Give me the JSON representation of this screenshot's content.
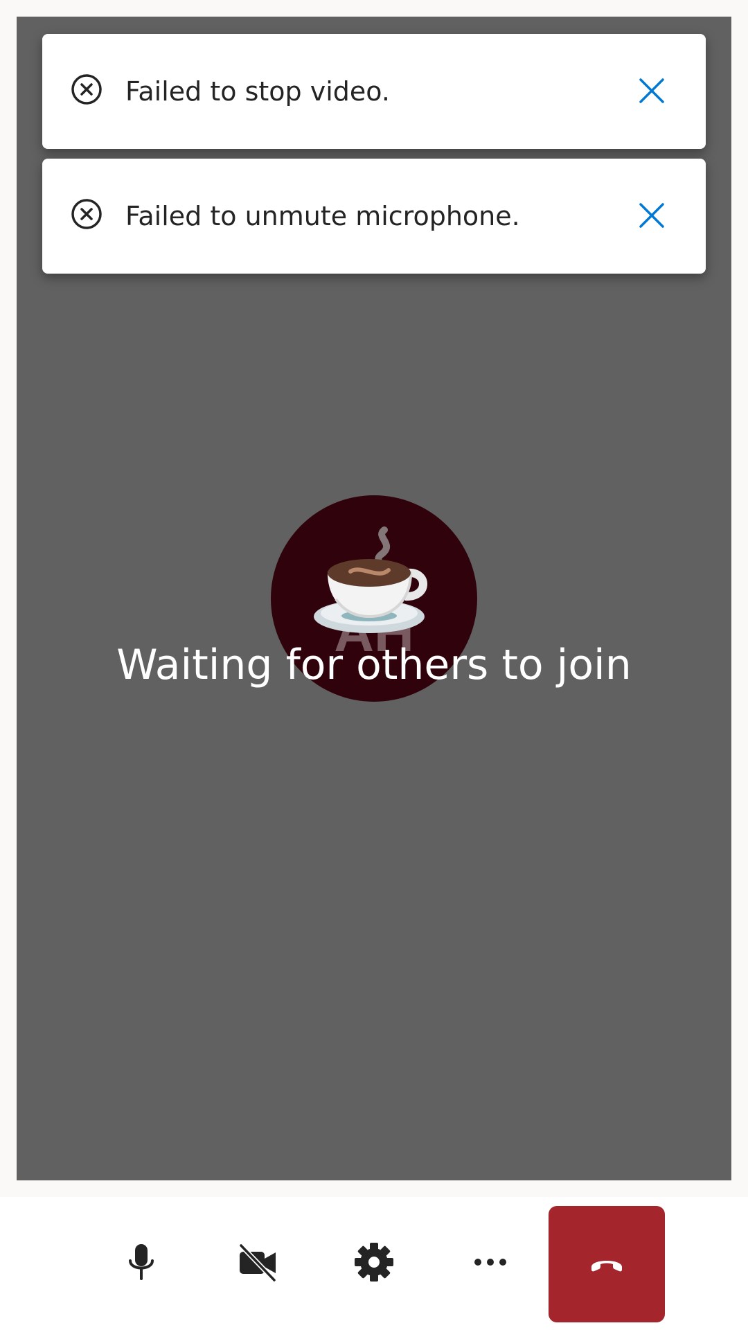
{
  "notifications": [
    {
      "message": "Failed to stop video.",
      "icon": "error-circle-icon",
      "dismiss_icon": "close-icon"
    },
    {
      "message": "Failed to unmute microphone.",
      "icon": "error-circle-icon",
      "dismiss_icon": "close-icon"
    }
  ],
  "stage": {
    "status_text": "Waiting for others to join",
    "avatar": {
      "initials": "AH",
      "emoji": "hot-beverage-icon",
      "background_color": "#30020c"
    },
    "background_color": "#616161"
  },
  "controls": {
    "microphone": "microphone-icon",
    "camera": "camera-off-icon",
    "settings": "gear-icon",
    "more": "more-options-icon",
    "hangup": "hang-up-icon",
    "hangup_color": "#a4262c",
    "accent_color": "#0078d4"
  }
}
